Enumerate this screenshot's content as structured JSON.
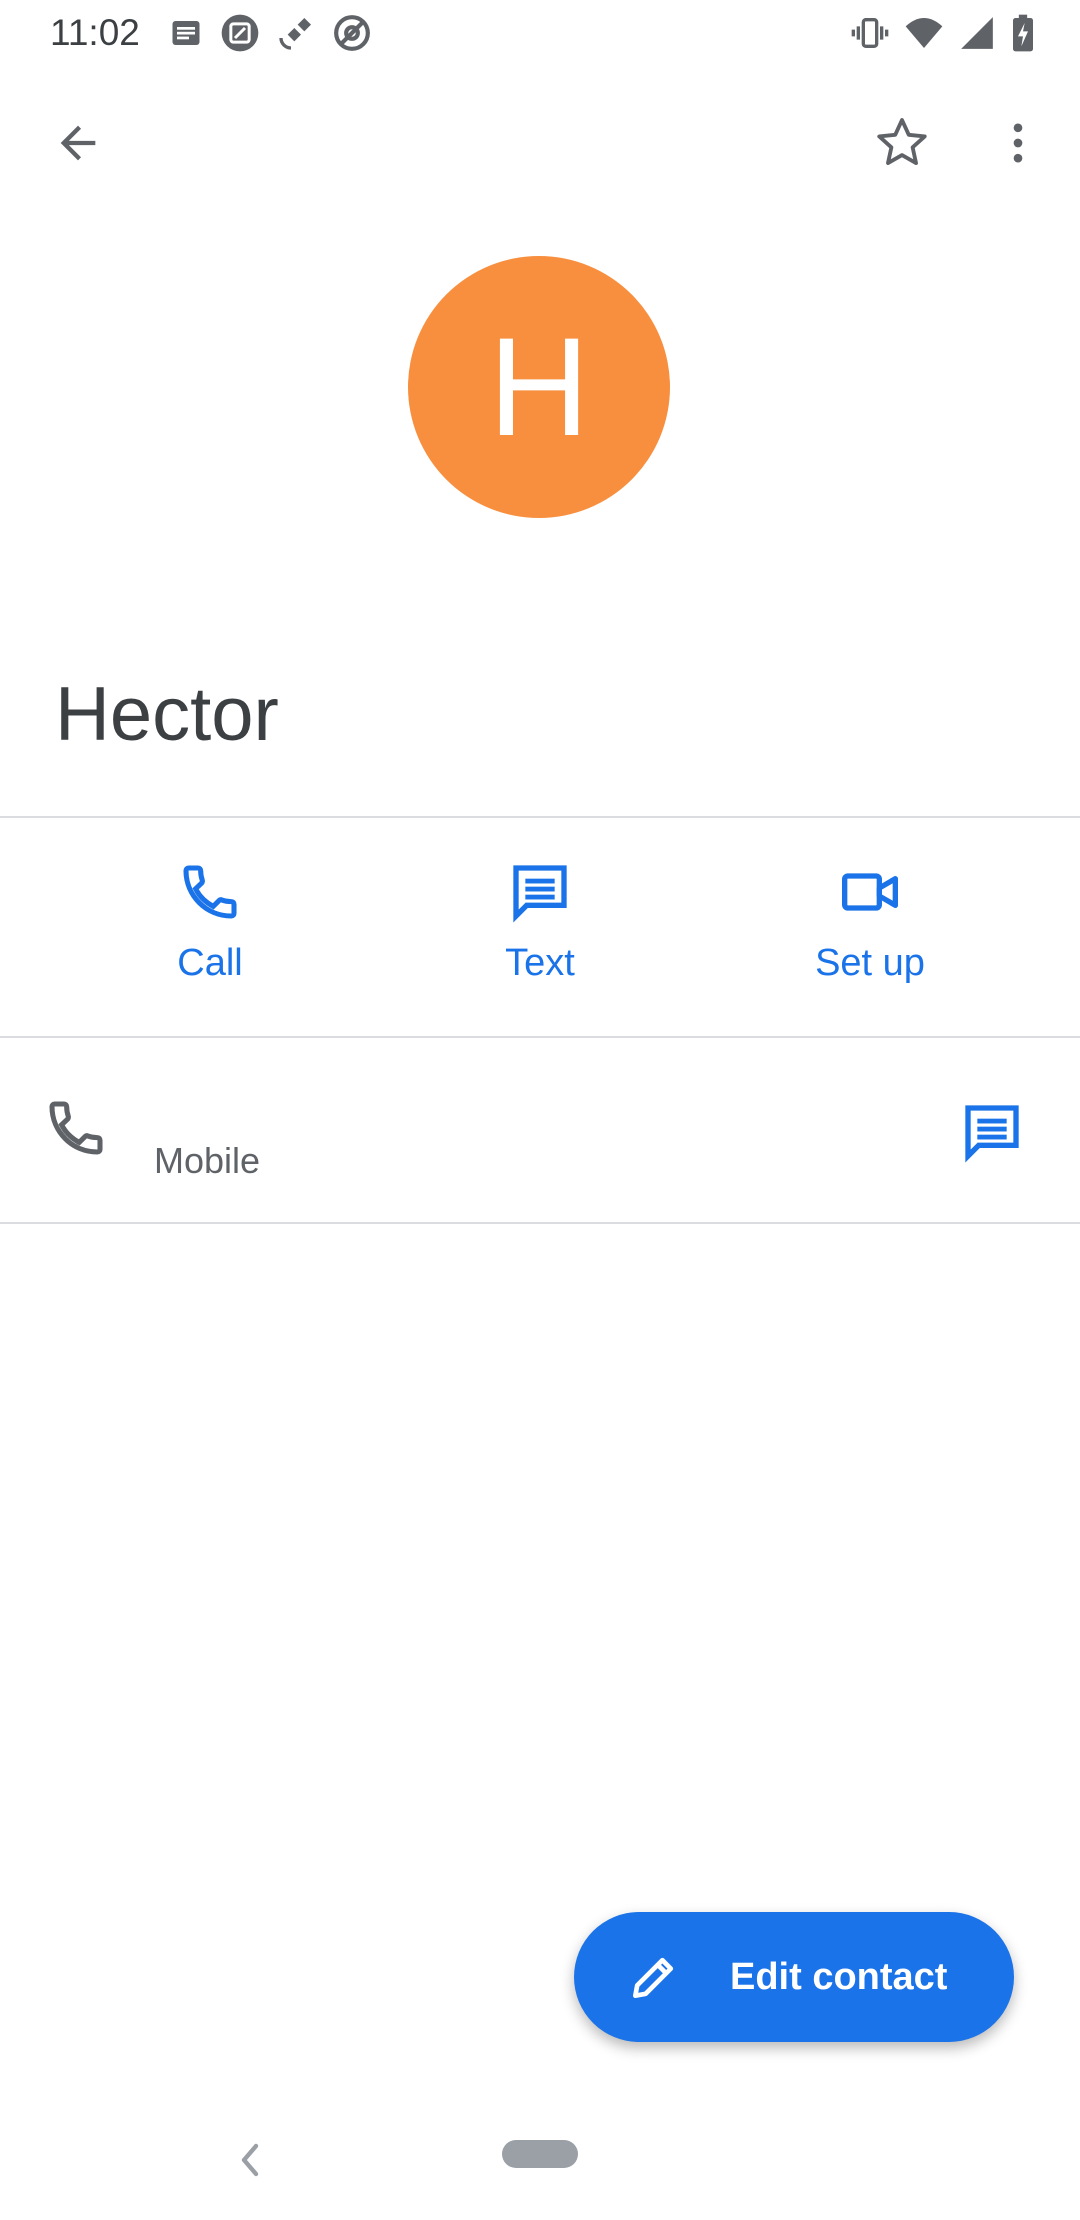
{
  "status_bar": {
    "time": "11:02",
    "left_icons": [
      "message-icon",
      "screenshot-icon",
      "satellite-icon",
      "at-sign-icon"
    ],
    "right_icons": [
      "vibrate-icon",
      "wifi-icon",
      "cell-signal-icon",
      "battery-charging-icon"
    ]
  },
  "top_bar": {
    "back_icon": "arrow-back-icon",
    "star_icon": "star-outline-icon",
    "more_icon": "more-vert-icon"
  },
  "contact": {
    "initial": "H",
    "name": "Hector",
    "avatar_color": "#f88f3e"
  },
  "actions": [
    {
      "label": "Call",
      "icon": "phone-icon"
    },
    {
      "label": "Text",
      "icon": "message-icon"
    },
    {
      "label": "Set up",
      "icon": "video-call-icon"
    }
  ],
  "phone_entry": {
    "label": "Mobile",
    "leading_icon": "phone-icon",
    "trailing_icon": "message-icon"
  },
  "fab": {
    "label": "Edit contact",
    "icon": "pencil-icon"
  },
  "colors": {
    "accent": "#1a73e8",
    "divider": "#dadce0",
    "text_primary": "#3c4043",
    "text_secondary": "#5f6368"
  }
}
